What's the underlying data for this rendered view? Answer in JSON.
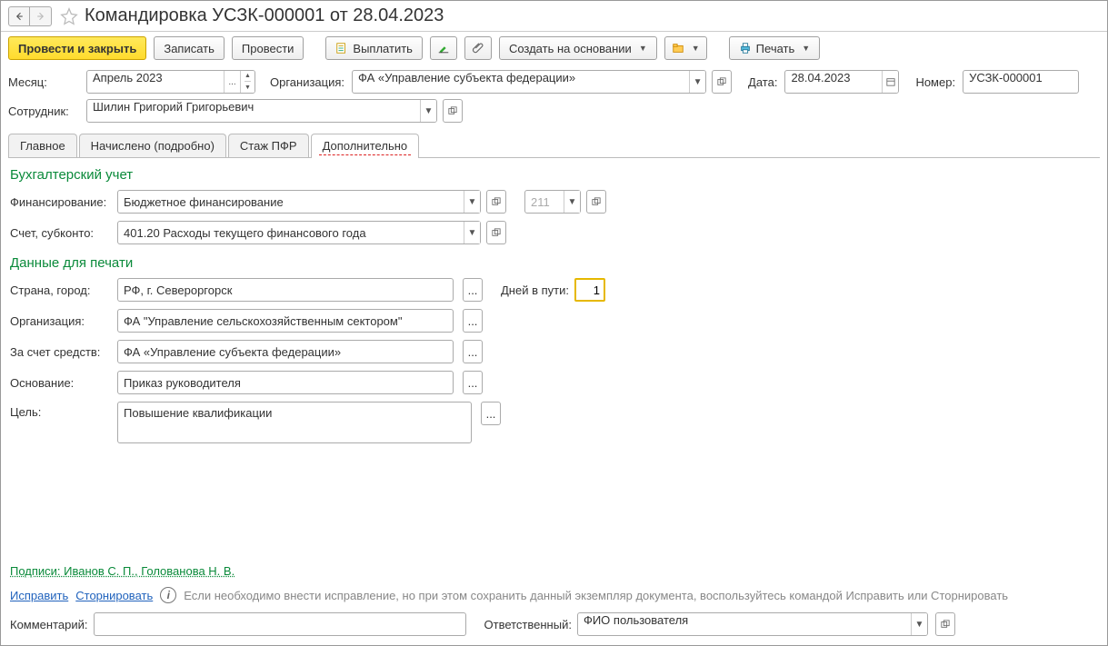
{
  "title": "Командировка УСЗК-000001 от 28.04.2023",
  "nav": {
    "back": "←",
    "forward": "→"
  },
  "toolbar": {
    "post_close": "Провести и закрыть",
    "save": "Записать",
    "post": "Провести",
    "pay": "Выплатить",
    "create_based": "Создать на основании",
    "print": "Печать"
  },
  "header": {
    "month_lbl": "Месяц:",
    "month_val": "Апрель 2023",
    "org_lbl": "Организация:",
    "org_val": "ФА «Управление субъекта федерации»",
    "date_lbl": "Дата:",
    "date_val": "28.04.2023",
    "num_lbl": "Номер:",
    "num_val": "УСЗК-000001",
    "emp_lbl": "Сотрудник:",
    "emp_val": "Шилин Григорий Григорьевич"
  },
  "tabs": {
    "main": "Главное",
    "accrued": "Начислено (подробно)",
    "pfr": "Стаж ПФР",
    "extra": "Дополнительно"
  },
  "accounting": {
    "title": "Бухгалтерский учет",
    "fin_lbl": "Финансирование:",
    "fin_val": "Бюджетное финансирование",
    "kosgu_placeholder": "211",
    "acc_lbl": "Счет, субконто:",
    "acc_val": "401.20 Расходы текущего финансового года"
  },
  "printdata": {
    "title": "Данные для печати",
    "country_lbl": "Страна, город:",
    "country_val": "РФ, г. Североргорск",
    "days_lbl": "Дней в пути:",
    "days_val": "1",
    "org_lbl": "Организация:",
    "org_val": "ФА \"Управление сельскохозяйственным сектором\"",
    "funds_lbl": "За счет средств:",
    "funds_val": "ФА «Управление субъекта федерации»",
    "basis_lbl": "Основание:",
    "basis_val": "Приказ руководителя",
    "goal_lbl": "Цель:",
    "goal_val": "Повышение квалификации"
  },
  "footer": {
    "signs": "Подписи: Иванов С. П., Голованова Н. В.",
    "correct": "Исправить",
    "storno": "Сторнировать",
    "info": "Если необходимо внести исправление, но при этом сохранить данный экземпляр документа, воспользуйтесь командой Исправить или Сторнировать",
    "comment_lbl": "Комментарий:",
    "resp_lbl": "Ответственный:",
    "resp_val": "ФИО пользователя"
  }
}
